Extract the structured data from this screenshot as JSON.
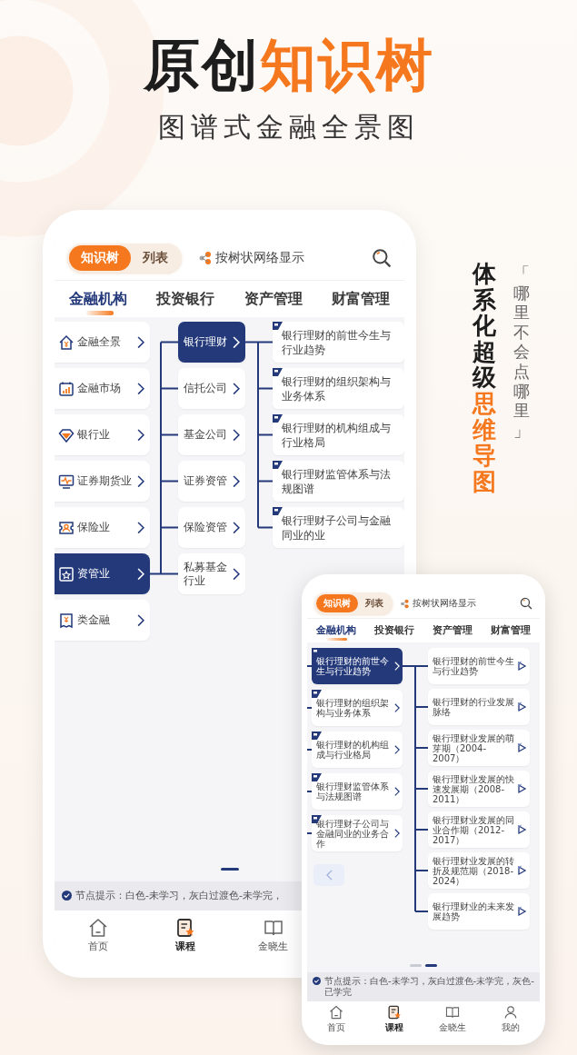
{
  "headline": {
    "parts": [
      {
        "text": "原创",
        "accent": false
      },
      {
        "text": "知识树",
        "accent": true
      }
    ]
  },
  "subtitle": "图谱式金融全景图",
  "slogan": {
    "parts": [
      {
        "text": "体系化超级",
        "accent": false
      },
      {
        "text": "思维导图",
        "accent": true
      }
    ],
    "aside": "「哪里不会点哪里」"
  },
  "back_phone": {
    "view_toggle": [
      {
        "label": "知识树",
        "selected": true
      },
      {
        "label": "列表",
        "selected": false
      }
    ],
    "network_toggle": "按树状网络显示",
    "tabs": [
      {
        "label": "金融机构",
        "selected": true
      },
      {
        "label": "投资银行",
        "selected": false
      },
      {
        "label": "资产管理",
        "selected": false
      },
      {
        "label": "财富管理",
        "selected": false
      }
    ],
    "categories": [
      {
        "label": "金融全景",
        "kind": "house",
        "selected": false
      },
      {
        "label": "金融市场",
        "kind": "calendar",
        "selected": false
      },
      {
        "label": "银行业",
        "kind": "diamond",
        "selected": false
      },
      {
        "label": "证券期货业",
        "kind": "monitor",
        "selected": false
      },
      {
        "label": "保险业",
        "kind": "badge",
        "selected": false
      },
      {
        "label": "资管业",
        "kind": "starbox",
        "selected": true
      },
      {
        "label": "类金融",
        "kind": "receipt",
        "selected": false
      }
    ],
    "subcategories": [
      {
        "label": "银行理财",
        "selected": true
      },
      {
        "label": "信托公司",
        "selected": false
      },
      {
        "label": "基金公司",
        "selected": false
      },
      {
        "label": "证券资管",
        "selected": false
      },
      {
        "label": "保险资管",
        "selected": false
      },
      {
        "label": "私募基金行业",
        "selected": false
      }
    ],
    "topics": [
      {
        "label": "银行理财的前世今生与行业趋势"
      },
      {
        "label": "银行理财的组织架构与业务体系"
      },
      {
        "label": "银行理财的机构组成与行业格局"
      },
      {
        "label": "银行理财监管体系与法规图谱"
      },
      {
        "label": "银行理财子公司与金融同业的业"
      }
    ],
    "pager": [
      {
        "selected": true
      }
    ],
    "hint": "节点提示：白色-未学习，灰白过渡色-未学完，",
    "nav": [
      {
        "label": "首页",
        "kind": "home",
        "selected": false
      },
      {
        "label": "课程",
        "kind": "course",
        "selected": true
      },
      {
        "label": "金晓生",
        "kind": "book",
        "selected": false
      }
    ]
  },
  "front_phone": {
    "view_toggle": [
      {
        "label": "知识树",
        "selected": true
      },
      {
        "label": "列表",
        "selected": false
      }
    ],
    "network_toggle": "按树状网络显示",
    "tabs": [
      {
        "label": "金融机构",
        "selected": true
      },
      {
        "label": "投资银行",
        "selected": false
      },
      {
        "label": "资产管理",
        "selected": false
      },
      {
        "label": "财富管理",
        "selected": false
      }
    ],
    "topics": [
      {
        "label": "银行理财的前世今生与行业趋势",
        "selected": true
      },
      {
        "label": "银行理财的组织架构与业务体系",
        "selected": false
      },
      {
        "label": "银行理财的机构组成与行业格局",
        "selected": false
      },
      {
        "label": "银行理财监管体系与法规图谱",
        "selected": false
      },
      {
        "label": "银行理财子公司与金融同业的业务合作",
        "selected": false
      }
    ],
    "lessons": [
      {
        "label": "银行理财的前世今生与行业趋势"
      },
      {
        "label": "银行理财的行业发展脉络"
      },
      {
        "label": "银行理财业发展的萌芽期（2004-2007）"
      },
      {
        "label": "银行理财业发展的快速发展期（2008-2011）"
      },
      {
        "label": "银行理财业发展的同业合作期（2012-2017）"
      },
      {
        "label": "银行理财业发展的转折及规范期（2018-2024）"
      },
      {
        "label": "银行理财业的未来发展趋势"
      }
    ],
    "pager": [
      {
        "selected": false
      },
      {
        "selected": true
      }
    ],
    "hint": "节点提示：白色-未学习，灰白过渡色-未学完，灰色-已学完",
    "nav": [
      {
        "label": "首页",
        "kind": "home",
        "selected": false
      },
      {
        "label": "课程",
        "kind": "course",
        "selected": true
      },
      {
        "label": "金晓生",
        "kind": "book",
        "selected": false
      },
      {
        "label": "我的",
        "kind": "person",
        "selected": false
      }
    ]
  }
}
